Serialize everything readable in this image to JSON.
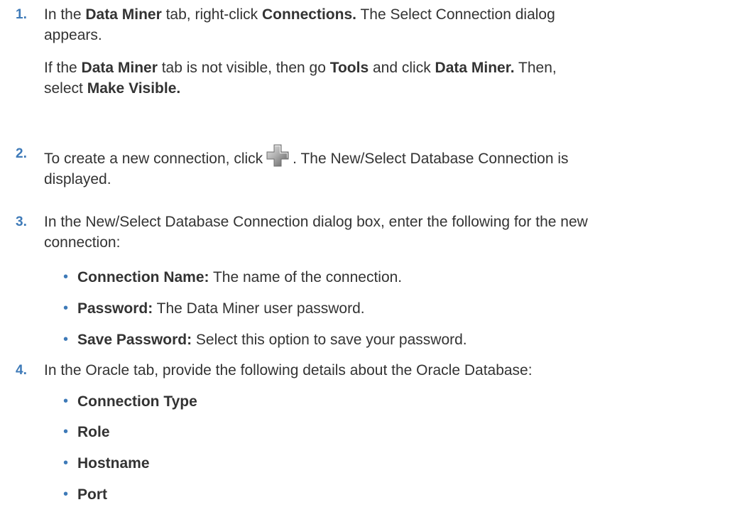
{
  "steps": [
    {
      "number": "1.",
      "line1_a": "In the ",
      "line1_b": "Data Miner",
      "line1_c": " tab, right-click ",
      "line1_d": "Connections.",
      "line1_e": " The Select Connection dialog",
      "line2": "appears.",
      "note_a": "If the ",
      "note_b": "Data Miner",
      "note_c": " tab is not visible, then go ",
      "note_d": "Tools",
      "note_e": " and click ",
      "note_f": "Data Miner.",
      "note_g": " Then,",
      "note2_a": "select ",
      "note2_b": "Make Visible."
    },
    {
      "number": "2.",
      "line1_a": "To create a new connection, click",
      "line1_b": ". The New/Select Database Connection is",
      "line2": "displayed.",
      "icon": "add-connection-icon"
    },
    {
      "number": "3.",
      "line1": "In the New/Select Database Connection dialog box, enter the following for the new",
      "line2": "connection:",
      "bullets": [
        {
          "label": "Connection Name:",
          "text": " The name of the connection."
        },
        {
          "label": "Password:",
          "text": " The Data Miner user password."
        },
        {
          "label": "Save Password:",
          "text": " Select this option to save your password."
        }
      ]
    },
    {
      "number": "4.",
      "line1": "In the Oracle tab, provide the following details about the Oracle Database:",
      "bullets": [
        {
          "label": "Connection Type"
        },
        {
          "label": "Role"
        },
        {
          "label": "Hostname"
        },
        {
          "label": "Port"
        }
      ]
    }
  ],
  "bullet_glyph": "•",
  "colors": {
    "text": "#333333",
    "accent": "#3e7ab8"
  }
}
